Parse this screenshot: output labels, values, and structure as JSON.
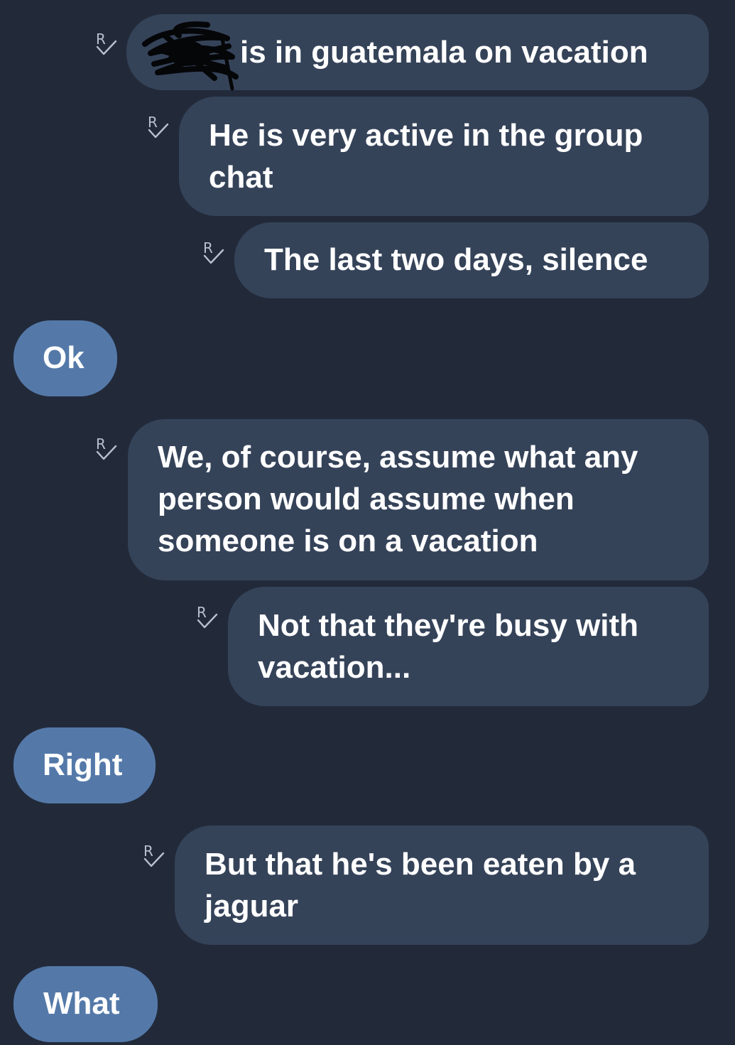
{
  "conversation": {
    "messages": [
      {
        "side": "received",
        "text": "is in guatemala on vacation",
        "receipt": "R",
        "sender_name_redacted": true
      },
      {
        "side": "received",
        "text": "He is very active in the group chat",
        "receipt": "R"
      },
      {
        "side": "received",
        "text": "The last two days, silence",
        "receipt": "R"
      },
      {
        "side": "sent",
        "text": "Ok"
      },
      {
        "side": "received",
        "text": "We, of course, assume what any person would assume when someone is on a vacation",
        "receipt": "R"
      },
      {
        "side": "received",
        "text": "Not that they're busy with vacation...",
        "receipt": "R"
      },
      {
        "side": "sent",
        "text": "Right"
      },
      {
        "side": "received",
        "text": "But that he's been eaten by a jaguar",
        "receipt": "R"
      },
      {
        "side": "sent",
        "text": "What"
      }
    ]
  },
  "colors": {
    "background": "#222a3a",
    "received_bubble": "#354359",
    "sent_bubble": "#5479a9",
    "text": "#ffffff",
    "receipt_icon": "#b9c1cf"
  },
  "icons": {
    "receipt": "read-receipt-R-check-icon"
  }
}
